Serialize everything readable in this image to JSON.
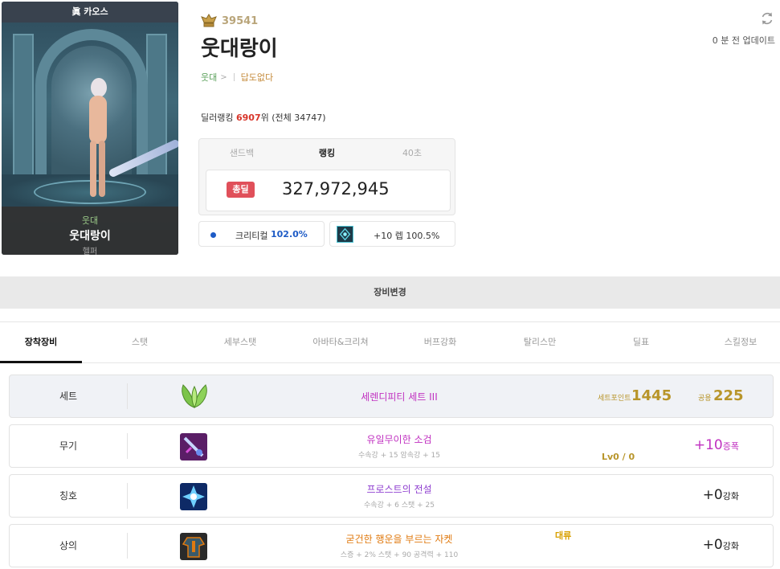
{
  "card": {
    "server": "眞 카오스",
    "guild": "웃대",
    "name": "웃대랑이",
    "job": "헬퍼"
  },
  "profile": {
    "fame": "39541",
    "name": "웃대랑이",
    "guild": "웃대",
    "guild_arrow": ">",
    "adventure": "답도없다",
    "update_text": "0 분 전 업데이트"
  },
  "ranking": {
    "prefix": "딜러랭킹 ",
    "rank": "6907",
    "suffix": "위 (전체 34747)"
  },
  "score": {
    "tabs": [
      "샌드백",
      "랭킹",
      "40초"
    ],
    "active_tab": 1,
    "badge": "총딜",
    "value": "327,972,945"
  },
  "crit": {
    "label": "크리티컬",
    "value": "102.0%"
  },
  "rune": {
    "text": "+10 렙 100.5%"
  },
  "equip_change": "장비변경",
  "tabs": [
    "장착장비",
    "스탯",
    "세부스탯",
    "아바타&크리쳐",
    "버프강화",
    "탈리스만",
    "딜표",
    "스킬정보"
  ],
  "set_row": {
    "label": "세트",
    "name": "세렌디피티 세트 III",
    "point_label": "세트포인트",
    "point_value": "1445",
    "common_label": "공용",
    "common_value": "225"
  },
  "items": [
    {
      "label": "무기",
      "name": "유일무이한 소검",
      "sub": "수속강 + 15 암속강 + 15",
      "level": "Lv0 / 0",
      "enh_value": "+10",
      "enh_unit": "증폭",
      "name_color": "#c030c0",
      "enh_color": "#c030c0"
    },
    {
      "label": "칭호",
      "name": "프로스트의 전설",
      "sub": "수속강 + 6 스탯 + 25",
      "enh_value": "+0",
      "enh_unit": "강화",
      "name_color": "#9040d0",
      "enh_color": "#222"
    },
    {
      "label": "상의",
      "name": "굳건한 행운을 부르는 자켓",
      "sub": "스증 + 2% 스탯 + 90 공격력 + 110",
      "tag": "대류",
      "enh_value": "+0",
      "enh_unit": "강화",
      "name_color": "#e07a10",
      "enh_color": "#222"
    }
  ],
  "colors": {
    "accent_red": "#d8352a",
    "fame_gold": "#b9a57a",
    "set_point_gold": "#b8952a",
    "crit_blue": "#1e5bc6",
    "set_name": "#c030c0",
    "guild_green": "#5aa05a"
  }
}
